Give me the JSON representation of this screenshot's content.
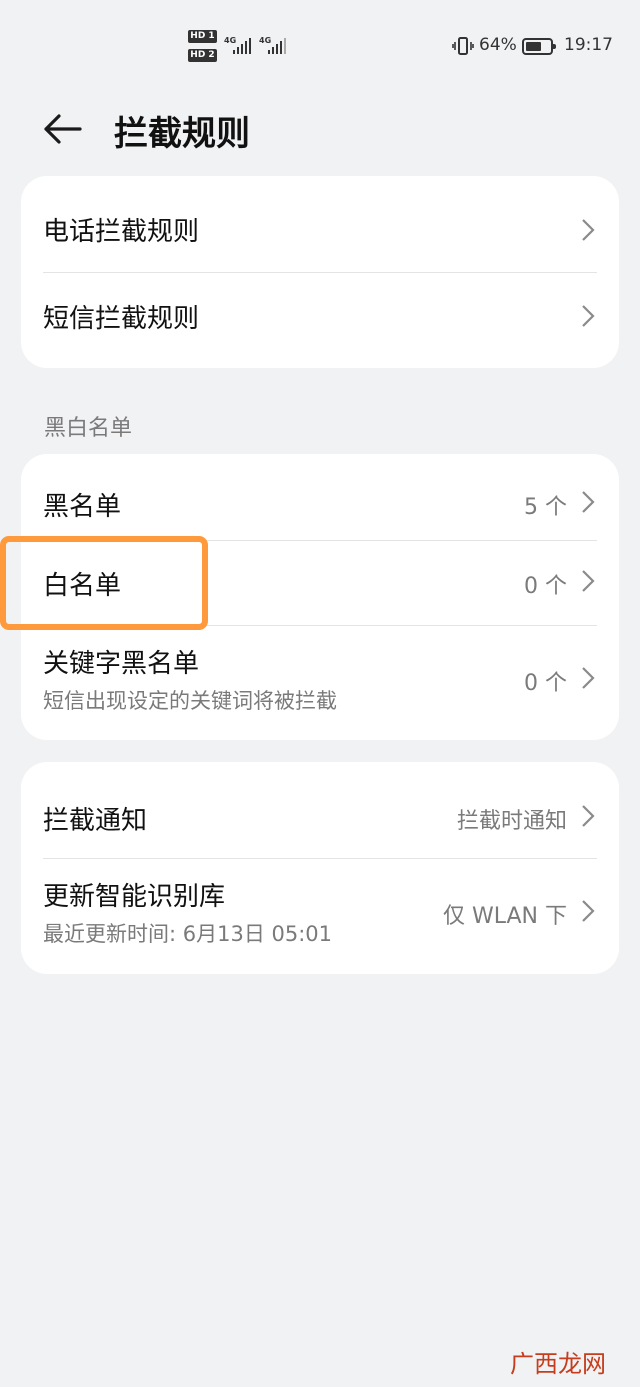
{
  "status_bar": {
    "sim1_tag": "HD 1",
    "sim2_tag": "HD 2",
    "sim1_network": "4G",
    "sim2_network": "4G",
    "battery_percent": "64%",
    "battery_level": 0.64,
    "time": "19:17"
  },
  "header": {
    "title": "拦截规则",
    "back_icon": "arrow-left-icon"
  },
  "rules_card": {
    "items": [
      {
        "label": "电话拦截规则"
      },
      {
        "label": "短信拦截规则"
      }
    ]
  },
  "lists_section": {
    "header": "黑白名单",
    "items": [
      {
        "label": "黑名单",
        "value": "5 个"
      },
      {
        "label": "白名单",
        "value": "0 个"
      },
      {
        "label": "关键字黑名单",
        "subtitle": "短信出现设定的关键词将被拦截",
        "value": "0 个"
      }
    ]
  },
  "settings_card": {
    "items": [
      {
        "label": "拦截通知",
        "value": "拦截时通知"
      },
      {
        "label": "更新智能识别库",
        "subtitle": "最近更新时间: 6月13日 05:01",
        "value": "仅 WLAN 下"
      }
    ]
  },
  "highlight": {
    "color": "#ff9a3c",
    "target": "白名单"
  },
  "watermark": {
    "text": "广西龙网"
  },
  "colors": {
    "background": "#f1f2f4",
    "card": "#ffffff",
    "secondary_text": "#7a7a7a",
    "highlight": "#ff9a3c"
  }
}
